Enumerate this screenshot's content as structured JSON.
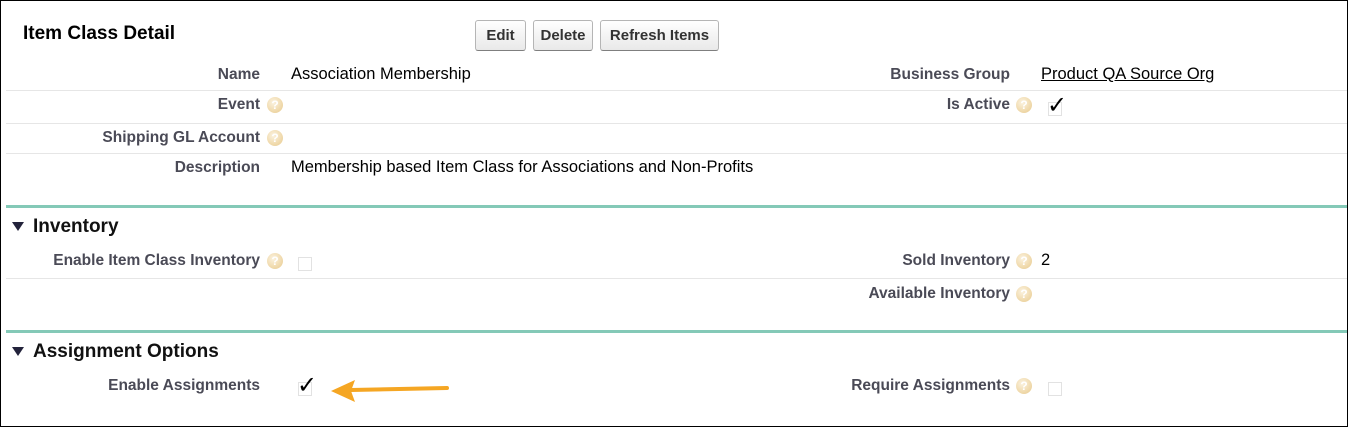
{
  "header": {
    "title": "Item Class Detail",
    "buttons": {
      "edit": "Edit",
      "delete": "Delete",
      "refresh": "Refresh Items"
    }
  },
  "detail": {
    "name_label": "Name",
    "name_value": "Association Membership",
    "business_group_label": "Business Group",
    "business_group_value": "Product QA Source Org",
    "event_label": "Event",
    "is_active_label": "Is Active",
    "is_active_checked": true,
    "shipping_gl_label": "Shipping GL Account",
    "description_label": "Description",
    "description_value": "Membership based Item Class for Associations and Non-Profits"
  },
  "inventory": {
    "section_title": "Inventory",
    "enable_label": "Enable Item Class Inventory",
    "enable_checked": false,
    "sold_label": "Sold Inventory",
    "sold_value": "2",
    "available_label": "Available Inventory"
  },
  "assignment": {
    "section_title": "Assignment Options",
    "enable_label": "Enable Assignments",
    "enable_checked": true,
    "require_label": "Require Assignments",
    "require_checked": false
  },
  "icons": {
    "help": "help-icon",
    "tick": "checkmark-icon",
    "collapse": "triangle-down-icon"
  },
  "colors": {
    "section_line": "#84c9b7",
    "arrow": "#f5a623",
    "help_bubble": "#f1dcb1"
  }
}
